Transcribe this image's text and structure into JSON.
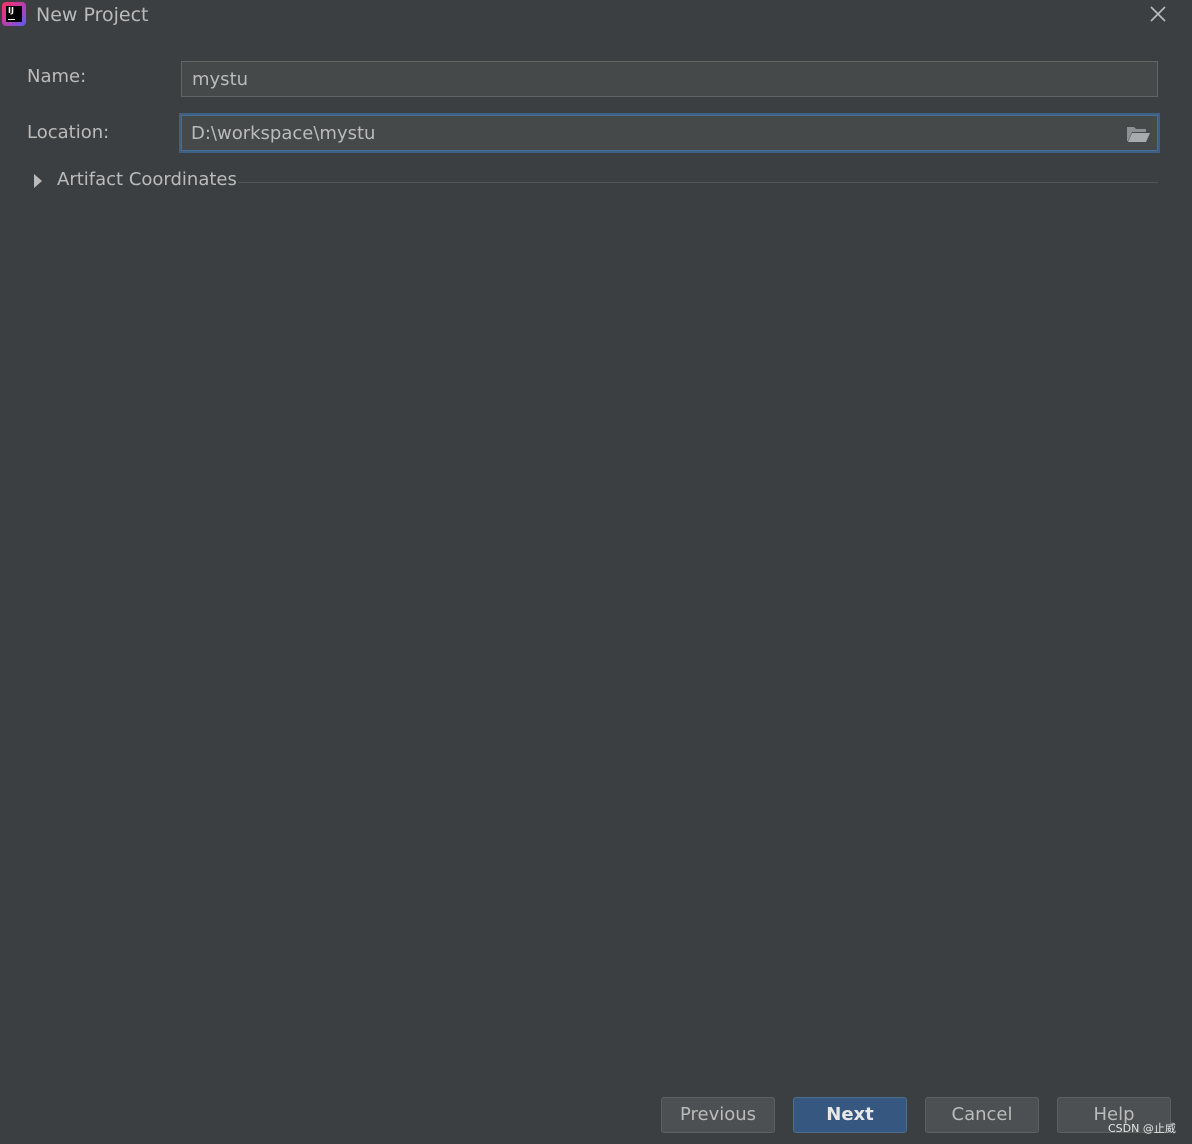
{
  "window": {
    "title": "New Project",
    "logo_icon": "intellij-idea-logo",
    "logo_text": "IJ",
    "close_icon": "close-icon"
  },
  "form": {
    "name_label": "Name:",
    "name_value": "mystu",
    "location_label": "Location:",
    "location_value": "D:\\workspace\\mystu",
    "browse_icon": "folder-open-icon"
  },
  "artifact": {
    "label": "Artifact Coordinates",
    "expanded": false
  },
  "buttons": {
    "previous": "Previous",
    "next": "Next",
    "cancel": "Cancel",
    "help": "Help"
  },
  "watermark": "CSDN @止威",
  "colors": {
    "background": "#3c3f41",
    "field_bg": "#45494a",
    "focus_border": "#3d6185",
    "primary_button": "#365880",
    "text": "#bbbbbb"
  }
}
